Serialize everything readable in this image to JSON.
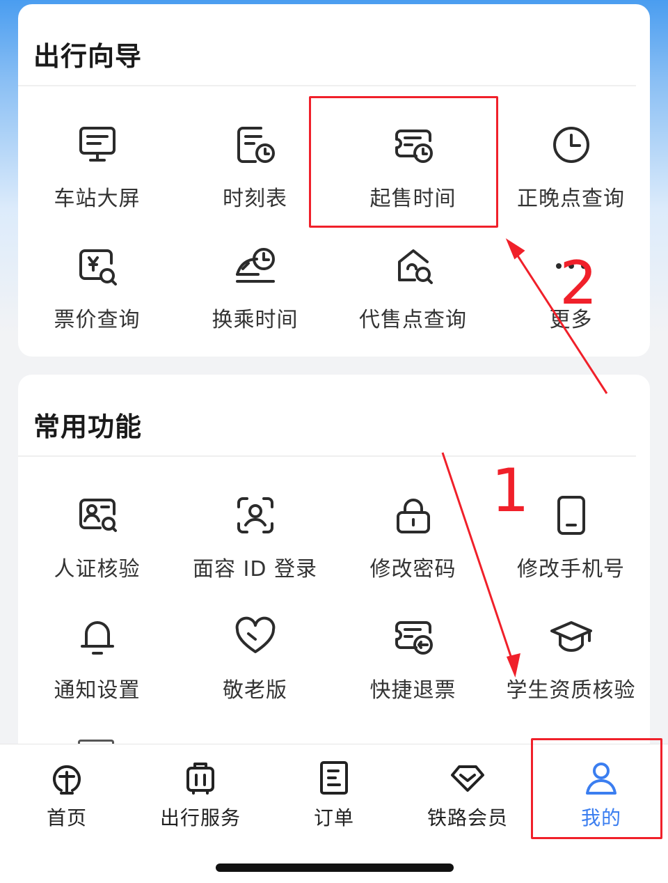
{
  "guide": {
    "title": "出行向导",
    "items": [
      {
        "label": "车站大屏",
        "icon": "monitor-icon"
      },
      {
        "label": "时刻表",
        "icon": "schedule-icon"
      },
      {
        "label": "起售时间",
        "icon": "ticket-clock-icon"
      },
      {
        "label": "正晚点查询",
        "icon": "clock-icon"
      },
      {
        "label": "票价查询",
        "icon": "price-search-icon"
      },
      {
        "label": "换乘时间",
        "icon": "train-clock-icon"
      },
      {
        "label": "代售点查询",
        "icon": "house-search-icon"
      },
      {
        "label": "更多",
        "icon": "more-dots-icon"
      }
    ]
  },
  "common": {
    "title": "常用功能",
    "items": [
      {
        "label": "人证核验",
        "icon": "id-card-verify-icon"
      },
      {
        "label": "面容 ID 登录",
        "icon": "face-id-icon"
      },
      {
        "label": "修改密码",
        "icon": "lock-icon"
      },
      {
        "label": "修改手机号",
        "icon": "phone-icon"
      },
      {
        "label": "通知设置",
        "icon": "bell-icon"
      },
      {
        "label": "敬老版",
        "icon": "heart-icon"
      },
      {
        "label": "快捷退票",
        "icon": "ticket-refund-icon"
      },
      {
        "label": "学生资质核验",
        "icon": "graduation-cap-icon"
      }
    ]
  },
  "tabbar": {
    "items": [
      {
        "label": "首页",
        "icon": "railway-logo-icon"
      },
      {
        "label": "出行服务",
        "icon": "luggage-icon"
      },
      {
        "label": "订单",
        "icon": "order-doc-icon"
      },
      {
        "label": "铁路会员",
        "icon": "diamond-icon"
      },
      {
        "label": "我的",
        "icon": "user-icon"
      }
    ],
    "active_index": 4,
    "active_color": "#3b7ef0"
  },
  "annotations": {
    "step_1": "1",
    "step_2": "2",
    "color": "#f0202a"
  }
}
